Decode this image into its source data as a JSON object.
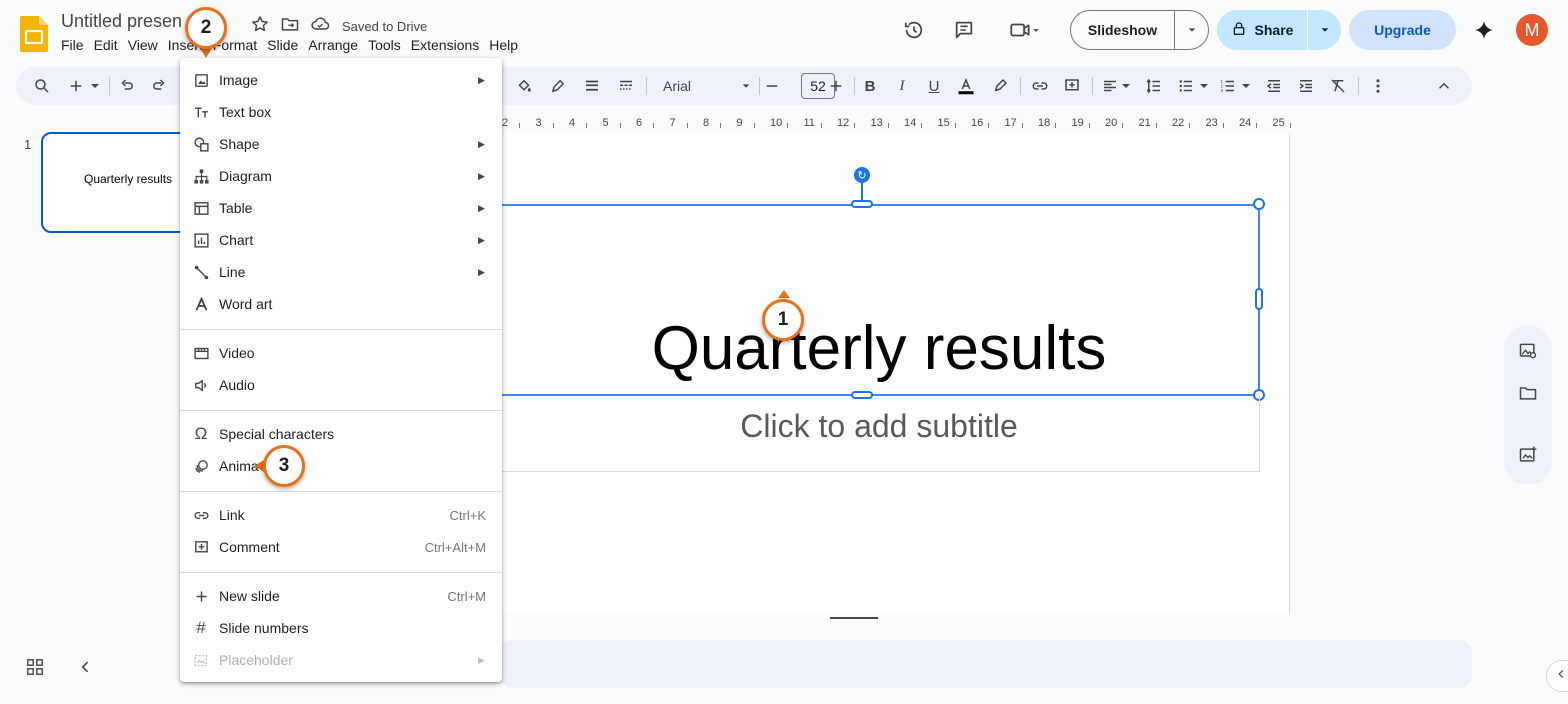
{
  "document": {
    "title": "Untitled presen",
    "saved_status": "Saved to Drive"
  },
  "menubar": [
    "File",
    "Edit",
    "View",
    "Insert",
    "Format",
    "Slide",
    "Arrange",
    "Tools",
    "Extensions",
    "Help"
  ],
  "header": {
    "slideshow_label": "Slideshow",
    "share_label": "Share",
    "upgrade_label": "Upgrade",
    "avatar_initial": "M"
  },
  "toolbar": {
    "font": "Arial",
    "font_size": "52"
  },
  "ruler": [
    "2",
    "3",
    "4",
    "5",
    "6",
    "7",
    "8",
    "9",
    "10",
    "11",
    "12",
    "13",
    "14",
    "15",
    "16",
    "17",
    "18",
    "19",
    "20",
    "21",
    "22",
    "23",
    "24",
    "25"
  ],
  "slides_panel": {
    "slide_number": "1",
    "thumb_text": "Quarterly results"
  },
  "slide": {
    "title": "Quarterly results",
    "subtitle_placeholder": "Click to add subtitle"
  },
  "insert_menu": {
    "group1": [
      {
        "label": "Image",
        "icon": "image-icon",
        "submenu": true
      },
      {
        "label": "Text box",
        "icon": "text-box-icon",
        "submenu": false
      },
      {
        "label": "Shape",
        "icon": "shape-icon",
        "submenu": true
      },
      {
        "label": "Diagram",
        "icon": "diagram-icon",
        "submenu": true
      },
      {
        "label": "Table",
        "icon": "table-icon",
        "submenu": true
      },
      {
        "label": "Chart",
        "icon": "chart-icon",
        "submenu": true
      },
      {
        "label": "Line",
        "icon": "line-icon",
        "submenu": true
      },
      {
        "label": "Word art",
        "icon": "word-art-icon",
        "submenu": false
      }
    ],
    "group2": [
      {
        "label": "Video",
        "icon": "video-icon"
      },
      {
        "label": "Audio",
        "icon": "audio-icon"
      }
    ],
    "group3": [
      {
        "label": "Special characters",
        "icon": "omega-icon"
      },
      {
        "label": "Anima",
        "icon": "animation-icon"
      }
    ],
    "group4": [
      {
        "label": "Link",
        "icon": "link-icon",
        "shortcut": "Ctrl+K"
      },
      {
        "label": "Comment",
        "icon": "comment-icon",
        "shortcut": "Ctrl+Alt+M"
      }
    ],
    "group5": [
      {
        "label": "New slide",
        "icon": "plus-icon",
        "shortcut": "Ctrl+M"
      },
      {
        "label": "Slide numbers",
        "icon": "hash-icon",
        "shortcut": ""
      },
      {
        "label": "Placeholder",
        "icon": "placeholder-icon",
        "submenu": true,
        "disabled": true
      }
    ]
  },
  "badges": [
    "1",
    "2",
    "3"
  ],
  "colors": {
    "accent": "#0b57d0",
    "badge_border": "#e8711a",
    "share_bg": "#c2e7ff",
    "upgrade_bg": "#d3e3fd",
    "avatar_bg": "#e8572a",
    "slides_yellow": "#f4b400"
  }
}
